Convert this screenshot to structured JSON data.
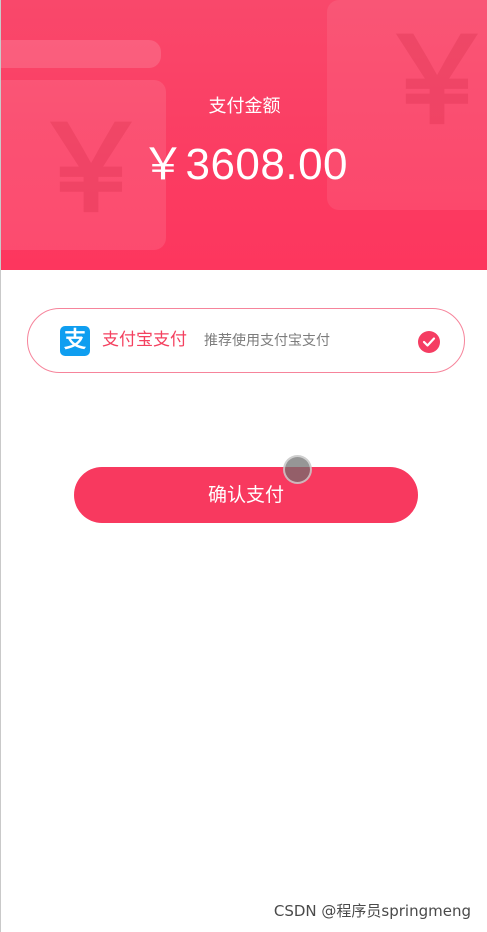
{
  "header": {
    "amount_label": "支付金额",
    "amount_value": "￥3608.00",
    "decor_glyph": "￥",
    "background_color": "#fb3c62"
  },
  "payment": {
    "icon": "alipay-icon",
    "icon_glyph": "支",
    "icon_color": "#0f9ef0",
    "name": "支付宝支付",
    "description": "推荐使用支付宝支付",
    "selected": true,
    "accent_color": "#f4405f"
  },
  "actions": {
    "confirm_label": "确认支付"
  },
  "watermark": {
    "text": "CSDN @程序员springmeng"
  }
}
